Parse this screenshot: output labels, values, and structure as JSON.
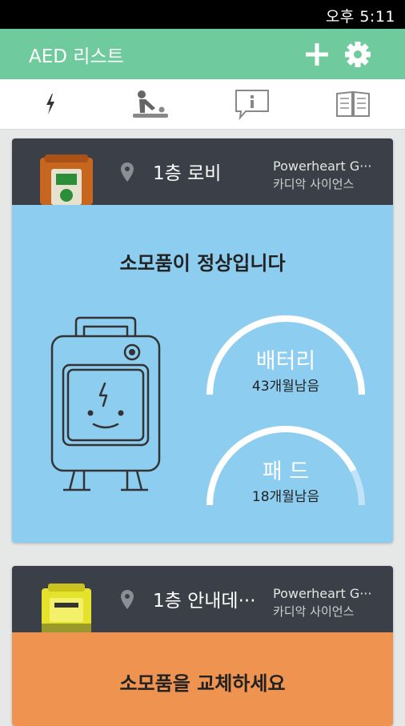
{
  "status_bar": {
    "time": "오후 5:11"
  },
  "app_bar": {
    "title": "AED 리스트"
  },
  "tabs": [
    {
      "id": "aed",
      "icon": "lightning-icon"
    },
    {
      "id": "cpr",
      "icon": "cpr-person-icon"
    },
    {
      "id": "info",
      "icon": "info-bubble-icon"
    },
    {
      "id": "guide",
      "icon": "open-book-icon"
    }
  ],
  "cards": [
    {
      "location": "1층 로비",
      "model": "Powerheart G···",
      "maker": "카디악 사이언스",
      "status_message": "소모품이 정상입니다",
      "status_color": "#8ccdf0",
      "battery": {
        "label": "배터리",
        "remaining": "43개월남음",
        "level": 1.0
      },
      "pad": {
        "label": "패 드",
        "remaining": "18개월남음",
        "level": 0.85
      }
    },
    {
      "location": "1층 안내데···",
      "model": "Powerheart G···",
      "maker": "카디악 사이언스",
      "status_message": "소모품을 교체하세요",
      "status_color": "#ef9351"
    }
  ],
  "colors": {
    "app_bar": "#6fcb9e",
    "card_header": "#3b3f47"
  }
}
